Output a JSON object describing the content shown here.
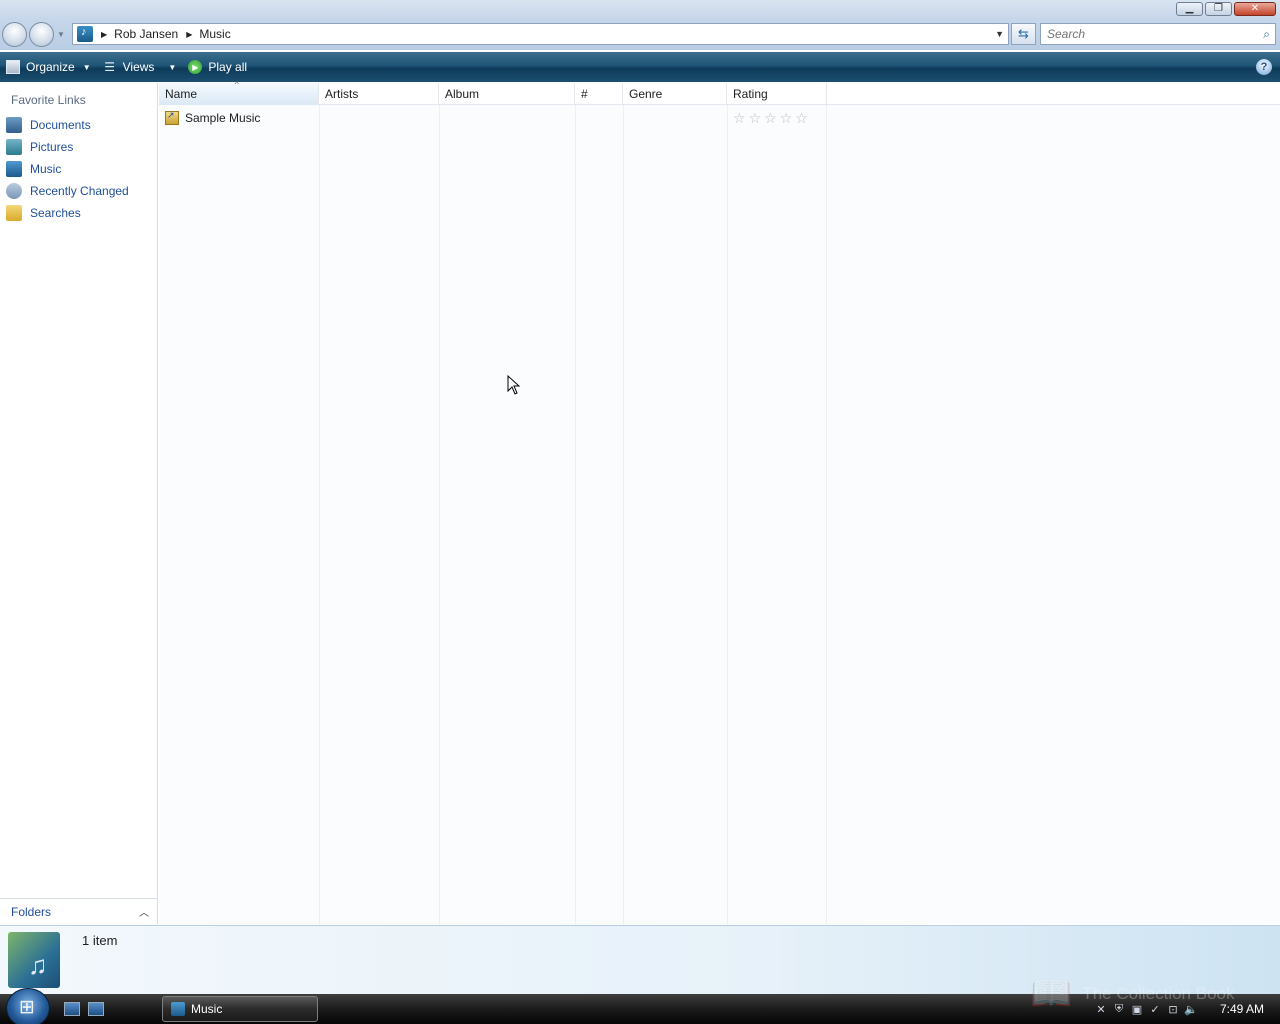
{
  "address": {
    "crumbs": [
      "Rob Jansen",
      "Music"
    ]
  },
  "search": {
    "placeholder": "Search"
  },
  "toolbar": {
    "organize_label": "Organize",
    "views_label": "Views",
    "play_all_label": "Play all",
    "help_label": "?"
  },
  "navpane": {
    "title": "Favorite Links",
    "items": [
      {
        "label": "Documents",
        "icon": "documents-icon"
      },
      {
        "label": "Pictures",
        "icon": "pictures-icon"
      },
      {
        "label": "Music",
        "icon": "music-icon"
      },
      {
        "label": "Recently Changed",
        "icon": "recently-changed-icon"
      },
      {
        "label": "Searches",
        "icon": "searches-icon"
      }
    ],
    "folders_label": "Folders"
  },
  "filelist": {
    "columns": [
      "Name",
      "Artists",
      "Album",
      "#",
      "Genre",
      "Rating"
    ],
    "sorted_column": "Name",
    "rows": [
      {
        "name": "Sample Music",
        "artists": "",
        "album": "",
        "track": "",
        "genre": "",
        "rating": 0
      }
    ]
  },
  "details": {
    "item_count": "1 item"
  },
  "taskbar": {
    "task_label": "Music",
    "watermark": "The Collection Book",
    "clock": "7:49 AM"
  },
  "colors": {
    "toolbar": "#1f5576",
    "link": "#1f4f9a",
    "taskbar": "#1b1b1b"
  }
}
